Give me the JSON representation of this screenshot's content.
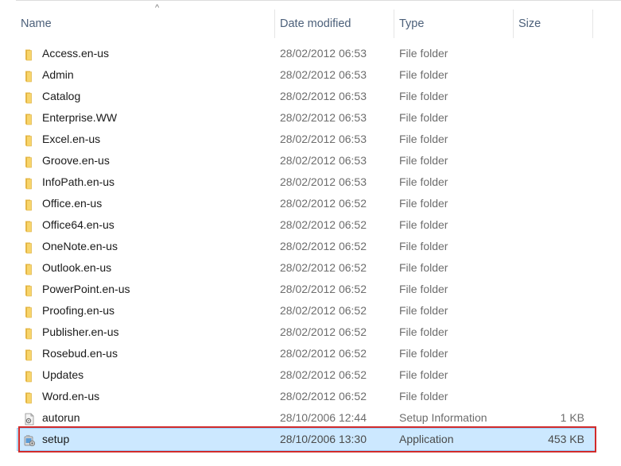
{
  "columns": {
    "name": "Name",
    "date_modified": "Date modified",
    "type": "Type",
    "size": "Size"
  },
  "sort_indicator": "^",
  "icons": {
    "folder": "folder-icon",
    "inf": "setup-information-file-icon",
    "app": "setup-application-icon"
  },
  "colors": {
    "selection_bg": "#cce8ff",
    "selection_border": "#99d1ff",
    "highlight_box": "#d12b2b",
    "folder_yellow": "#f8d56b"
  },
  "files": [
    {
      "name": "Access.en-us",
      "date": "28/02/2012 06:53",
      "type": "File folder",
      "size": "",
      "icon": "folder"
    },
    {
      "name": "Admin",
      "date": "28/02/2012 06:53",
      "type": "File folder",
      "size": "",
      "icon": "folder"
    },
    {
      "name": "Catalog",
      "date": "28/02/2012 06:53",
      "type": "File folder",
      "size": "",
      "icon": "folder"
    },
    {
      "name": "Enterprise.WW",
      "date": "28/02/2012 06:53",
      "type": "File folder",
      "size": "",
      "icon": "folder"
    },
    {
      "name": "Excel.en-us",
      "date": "28/02/2012 06:53",
      "type": "File folder",
      "size": "",
      "icon": "folder"
    },
    {
      "name": "Groove.en-us",
      "date": "28/02/2012 06:53",
      "type": "File folder",
      "size": "",
      "icon": "folder"
    },
    {
      "name": "InfoPath.en-us",
      "date": "28/02/2012 06:53",
      "type": "File folder",
      "size": "",
      "icon": "folder"
    },
    {
      "name": "Office.en-us",
      "date": "28/02/2012 06:52",
      "type": "File folder",
      "size": "",
      "icon": "folder"
    },
    {
      "name": "Office64.en-us",
      "date": "28/02/2012 06:52",
      "type": "File folder",
      "size": "",
      "icon": "folder"
    },
    {
      "name": "OneNote.en-us",
      "date": "28/02/2012 06:52",
      "type": "File folder",
      "size": "",
      "icon": "folder"
    },
    {
      "name": "Outlook.en-us",
      "date": "28/02/2012 06:52",
      "type": "File folder",
      "size": "",
      "icon": "folder"
    },
    {
      "name": "PowerPoint.en-us",
      "date": "28/02/2012 06:52",
      "type": "File folder",
      "size": "",
      "icon": "folder"
    },
    {
      "name": "Proofing.en-us",
      "date": "28/02/2012 06:52",
      "type": "File folder",
      "size": "",
      "icon": "folder"
    },
    {
      "name": "Publisher.en-us",
      "date": "28/02/2012 06:52",
      "type": "File folder",
      "size": "",
      "icon": "folder"
    },
    {
      "name": "Rosebud.en-us",
      "date": "28/02/2012 06:52",
      "type": "File folder",
      "size": "",
      "icon": "folder"
    },
    {
      "name": "Updates",
      "date": "28/02/2012 06:52",
      "type": "File folder",
      "size": "",
      "icon": "folder"
    },
    {
      "name": "Word.en-us",
      "date": "28/02/2012 06:52",
      "type": "File folder",
      "size": "",
      "icon": "folder"
    },
    {
      "name": "autorun",
      "date": "28/10/2006 12:44",
      "type": "Setup Information",
      "size": "1 KB",
      "icon": "inf"
    },
    {
      "name": "setup",
      "date": "28/10/2006 13:30",
      "type": "Application",
      "size": "453 KB",
      "icon": "app",
      "selected": true
    }
  ]
}
